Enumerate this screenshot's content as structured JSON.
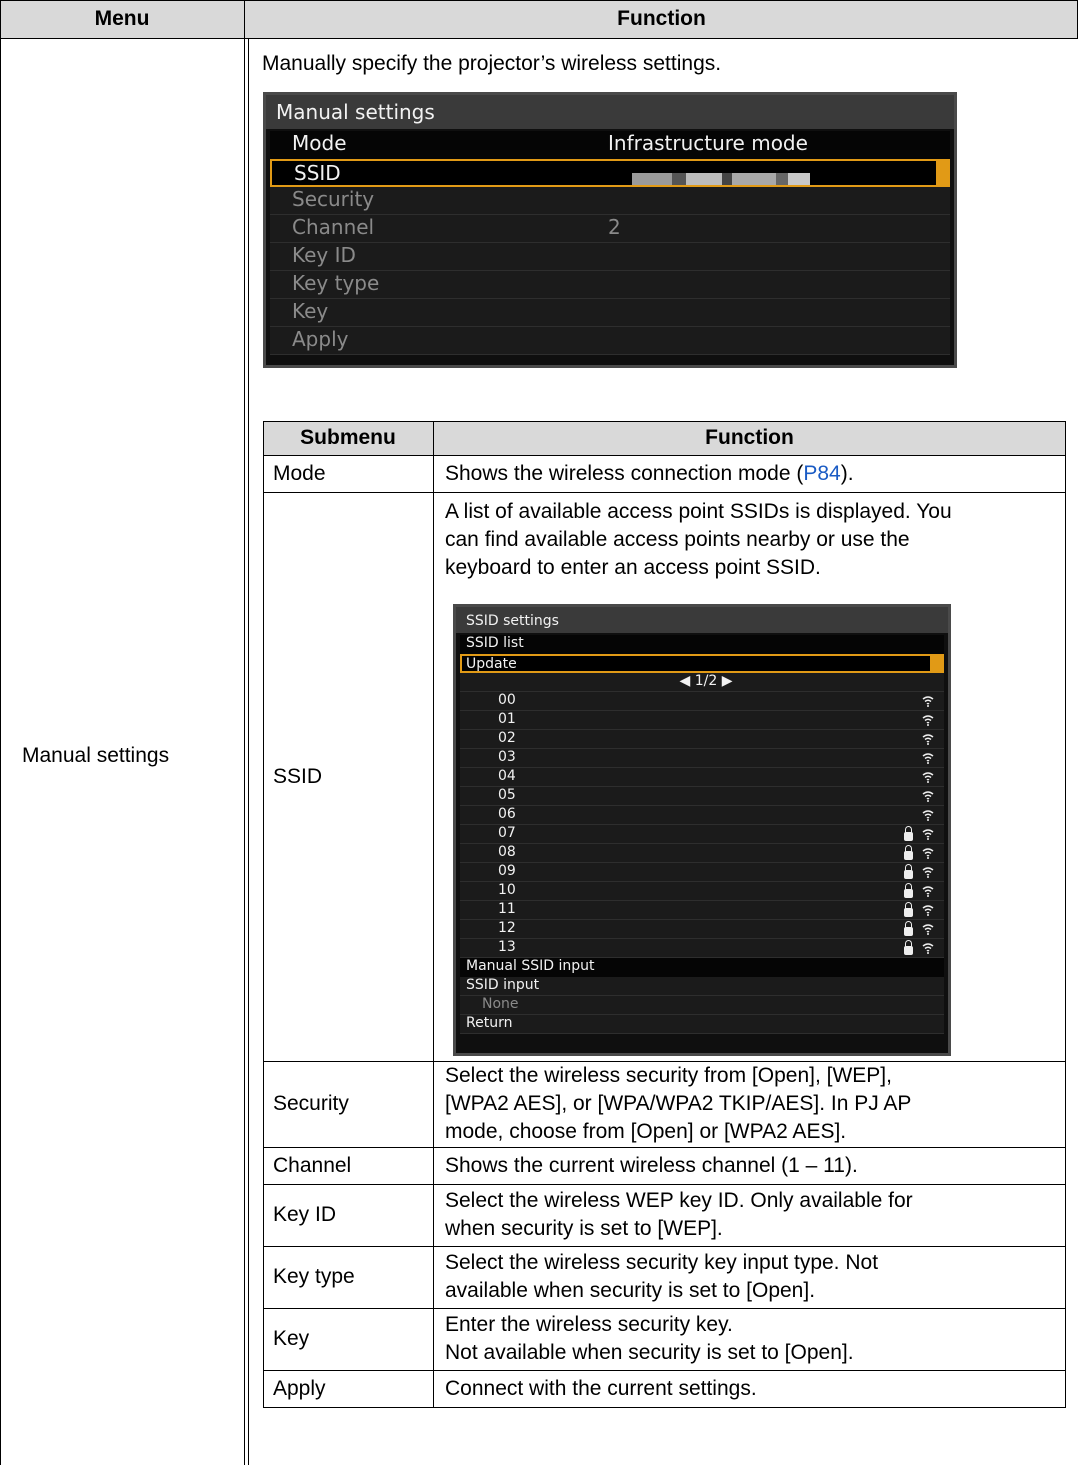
{
  "table": {
    "header_menu": "Menu",
    "header_function": "Function",
    "menu_name": "Manual settings",
    "intro": "Manually specify the projector’s wireless settings."
  },
  "osd_manual": {
    "title": "Manual settings",
    "rows": [
      {
        "label": "Mode",
        "value": "Infrastructure mode"
      },
      {
        "label": "SSID",
        "value": ""
      },
      {
        "label": "Security",
        "value": ""
      },
      {
        "label": "Channel",
        "value": "2"
      },
      {
        "label": "Key ID",
        "value": ""
      },
      {
        "label": "Key type",
        "value": ""
      },
      {
        "label": "Key",
        "value": ""
      },
      {
        "label": "Apply",
        "value": ""
      }
    ]
  },
  "subtable": {
    "header_submenu": "Submenu",
    "header_function": "Function",
    "rows": [
      {
        "submenu": "Mode",
        "function_pre": "Shows the wireless connection mode (",
        "link": "P84",
        "function_post": ")."
      },
      {
        "submenu": "SSID",
        "function_lines": [
          "A list of available access point SSIDs is displayed. You",
          "can find available access points nearby or use the",
          "keyboard to enter an access point SSID."
        ]
      },
      {
        "submenu": "Security",
        "function_lines": [
          "Select the wireless security from [Open], [WEP],",
          "[WPA2 AES], or [WPA/WPA2 TKIP/AES]. In PJ AP",
          "mode, choose from [Open] or [WPA2 AES]."
        ]
      },
      {
        "submenu": "Channel",
        "function_lines": [
          "Shows the current wireless channel (1 – 11)."
        ]
      },
      {
        "submenu": "Key ID",
        "function_lines": [
          "Select the wireless WEP key ID. Only available for",
          "when security is set to [WEP]."
        ]
      },
      {
        "submenu": "Key type",
        "function_lines": [
          "Select the wireless security key input type. Not",
          "available when security is set to [Open]."
        ]
      },
      {
        "submenu": "Key",
        "function_lines": [
          "Enter the wireless security key.",
          "Not available when security is set to [Open]."
        ]
      },
      {
        "submenu": "Apply",
        "function_lines": [
          "Connect with the current settings."
        ]
      }
    ]
  },
  "osd_ssid": {
    "title": "SSID settings",
    "list_label": "SSID list",
    "update_label": "Update",
    "pager": "◀ 1/2 ▶",
    "entries": [
      {
        "id": "00",
        "locked": false
      },
      {
        "id": "01",
        "locked": false
      },
      {
        "id": "02",
        "locked": false
      },
      {
        "id": "03",
        "locked": false
      },
      {
        "id": "04",
        "locked": false
      },
      {
        "id": "05",
        "locked": false
      },
      {
        "id": "06",
        "locked": false
      },
      {
        "id": "07",
        "locked": true
      },
      {
        "id": "08",
        "locked": true
      },
      {
        "id": "09",
        "locked": true
      },
      {
        "id": "10",
        "locked": true
      },
      {
        "id": "11",
        "locked": true
      },
      {
        "id": "12",
        "locked": true
      },
      {
        "id": "13",
        "locked": true
      }
    ],
    "manual_label": "Manual SSID input",
    "input_label": "SSID input",
    "input_value": "None",
    "return_label": "Return"
  },
  "colors": {
    "header_bg": "#d9d9d9",
    "link": "#1a5bc4",
    "osd_highlight": "#e19a16"
  }
}
